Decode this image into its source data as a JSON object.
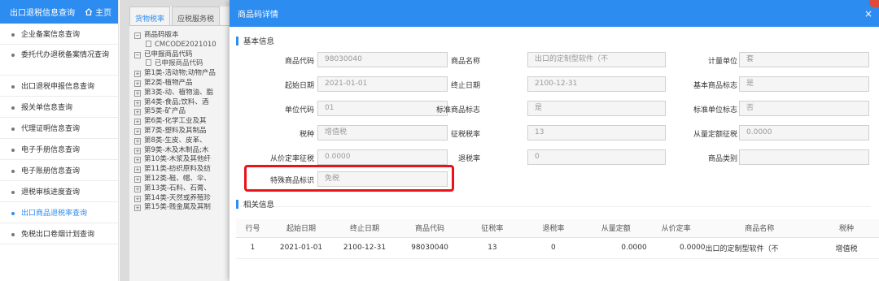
{
  "sidebar": {
    "title": "出口退税信息查询",
    "home_label": "主页",
    "items": [
      "企业备案信息查询",
      "委托代办退税备案情况查询",
      "出口退税申报信息查询",
      "报关单信息查询",
      "代理证明信息查询",
      "电子手册信息查询",
      "电子账册信息查询",
      "退税审核进度查询",
      "出口商品退税率查询",
      "免税出口卷烟计划查询"
    ],
    "active_index": 8
  },
  "background": {
    "tabs": [
      "货物税率",
      "应税服务税"
    ],
    "tree": [
      {
        "level": 0,
        "icon": "−",
        "text": "商品码版本"
      },
      {
        "level": 2,
        "icon": "file",
        "text": "CMCODE2021010"
      },
      {
        "level": 0,
        "icon": "−",
        "text": "已申报商品代码"
      },
      {
        "level": 2,
        "icon": "file",
        "text": "已申报商品代码"
      },
      {
        "level": 0,
        "icon": "+",
        "text": "第1类-活动物;动物产品"
      },
      {
        "level": 0,
        "icon": "+",
        "text": "第2类-植物产品"
      },
      {
        "level": 0,
        "icon": "+",
        "text": "第3类-动、植物油、脂"
      },
      {
        "level": 0,
        "icon": "+",
        "text": "第4类-食品;饮料、酒"
      },
      {
        "level": 0,
        "icon": "+",
        "text": "第5类-矿产品"
      },
      {
        "level": 0,
        "icon": "+",
        "text": "第6类-化学工业及其"
      },
      {
        "level": 0,
        "icon": "+",
        "text": "第7类-塑料及其制品"
      },
      {
        "level": 0,
        "icon": "+",
        "text": "第8类-生皮、皮革、"
      },
      {
        "level": 0,
        "icon": "+",
        "text": "第9类-木及木制品;木"
      },
      {
        "level": 0,
        "icon": "+",
        "text": "第10类-木浆及其他纤"
      },
      {
        "level": 0,
        "icon": "+",
        "text": "第11类-纺织原料及纺"
      },
      {
        "level": 0,
        "icon": "+",
        "text": "第12类-鞋、帽、伞、"
      },
      {
        "level": 0,
        "icon": "+",
        "text": "第13类-石料、石膏、"
      },
      {
        "level": 0,
        "icon": "+",
        "text": "第14类-天然或养殖珍"
      },
      {
        "level": 0,
        "icon": "+",
        "text": "第15类-贱金属及其制"
      }
    ]
  },
  "modal": {
    "title": "商品码详情",
    "close": "×",
    "basic_section": "基本信息",
    "related_section": "相关信息",
    "fields": [
      {
        "label": "商品代码",
        "value": "98030040"
      },
      {
        "label": "商品名称",
        "value": "出口的定制型软件（不"
      },
      {
        "label": "计量单位",
        "value": "套"
      },
      {
        "label": "起始日期",
        "value": "2021-01-01"
      },
      {
        "label": "终止日期",
        "value": "2100-12-31"
      },
      {
        "label": "基本商品标志",
        "value": "是"
      },
      {
        "label": "单位代码",
        "value": "01"
      },
      {
        "label": "标准商品标志",
        "value": "是"
      },
      {
        "label": "标准单位标志",
        "value": "否"
      },
      {
        "label": "税种",
        "value": "增值税"
      },
      {
        "label": "征税税率",
        "value": "13"
      },
      {
        "label": "从量定额征税",
        "value": "0.0000"
      },
      {
        "label": "从价定率征税",
        "value": "0.0000"
      },
      {
        "label": "退税率",
        "value": "0"
      },
      {
        "label": "商品类别",
        "value": ""
      },
      {
        "label": "特殊商品标识",
        "value": "免税"
      }
    ],
    "table": {
      "headers": [
        "行号",
        "起始日期",
        "终止日期",
        "商品代码",
        "征税率",
        "退税率",
        "从量定额",
        "从价定率",
        "商品名称",
        "税种"
      ],
      "rows": [
        [
          "1",
          "2021-01-01",
          "2100-12-31",
          "98030040",
          "13",
          "0",
          "0.0000",
          "0.0000",
          "出口的定制型软件（不",
          "增值税"
        ]
      ]
    }
  },
  "colors": {
    "accent": "#2d8cf0",
    "highlight": "#e8141a"
  }
}
